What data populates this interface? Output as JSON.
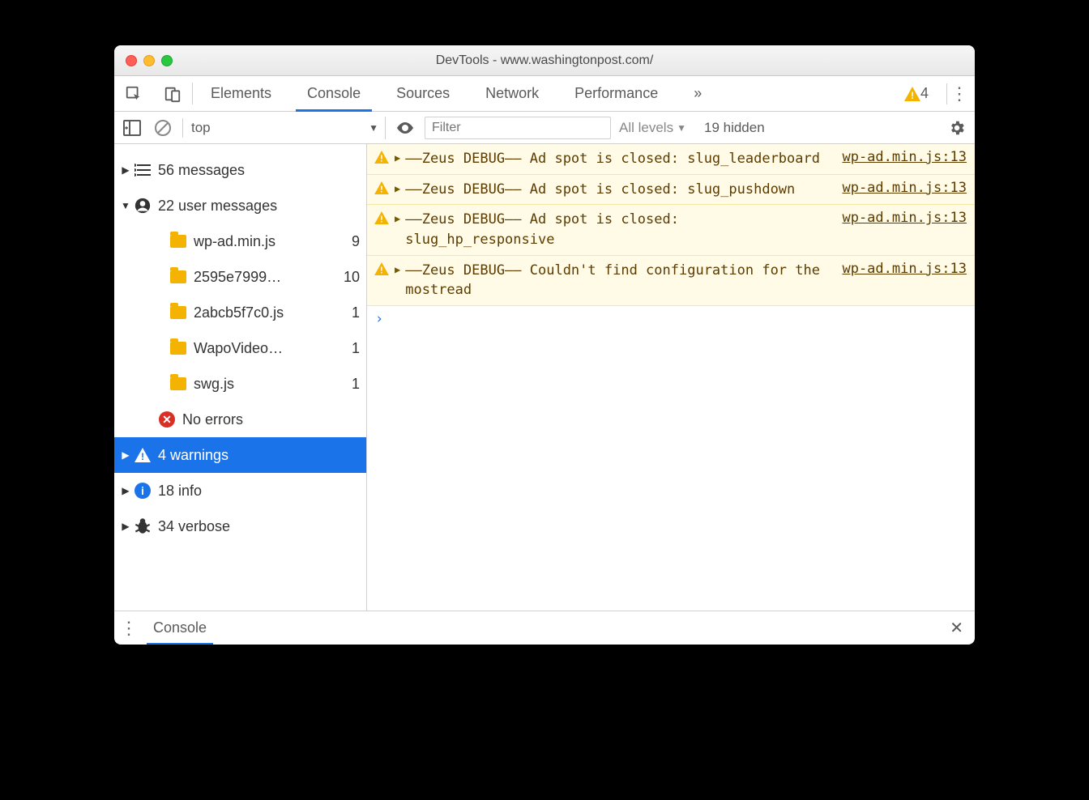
{
  "titlebar": {
    "title": "DevTools - www.washingtonpost.com/"
  },
  "tabs": {
    "items": [
      "Elements",
      "Console",
      "Sources",
      "Network",
      "Performance"
    ],
    "active_index": 1,
    "overflow_glyph": "»",
    "warn_count": "4"
  },
  "toolbar": {
    "context": "top",
    "filter_placeholder": "Filter",
    "levels_label": "All levels",
    "hidden_label": "19 hidden"
  },
  "sidebar": {
    "messages": {
      "label": "56 messages"
    },
    "user": {
      "label": "22 user messages",
      "files": [
        {
          "name": "wp-ad.min.js",
          "count": "9"
        },
        {
          "name": "2595e7999…",
          "count": "10"
        },
        {
          "name": "2abcb5f7c0.js",
          "count": "1"
        },
        {
          "name": "WapoVideo…",
          "count": "1"
        },
        {
          "name": "swg.js",
          "count": "1"
        }
      ]
    },
    "errors": {
      "label": "No errors"
    },
    "warnings": {
      "label": "4 warnings"
    },
    "info": {
      "label": "18 info"
    },
    "verbose": {
      "label": "34 verbose"
    }
  },
  "logs": [
    {
      "message": "––Zeus DEBUG–– Ad spot is closed: slug_leaderboard",
      "source": "wp-ad.min.js:13"
    },
    {
      "message": "––Zeus DEBUG–– Ad spot is closed: slug_pushdown",
      "source": "wp-ad.min.js:13"
    },
    {
      "message": "––Zeus DEBUG–– Ad spot is closed: slug_hp_responsive",
      "source": "wp-ad.min.js:13"
    },
    {
      "message": "––Zeus DEBUG–– Couldn't find configuration for the mostread",
      "source": "wp-ad.min.js:13"
    }
  ],
  "prompt_glyph": "›",
  "drawer": {
    "tab_label": "Console"
  }
}
